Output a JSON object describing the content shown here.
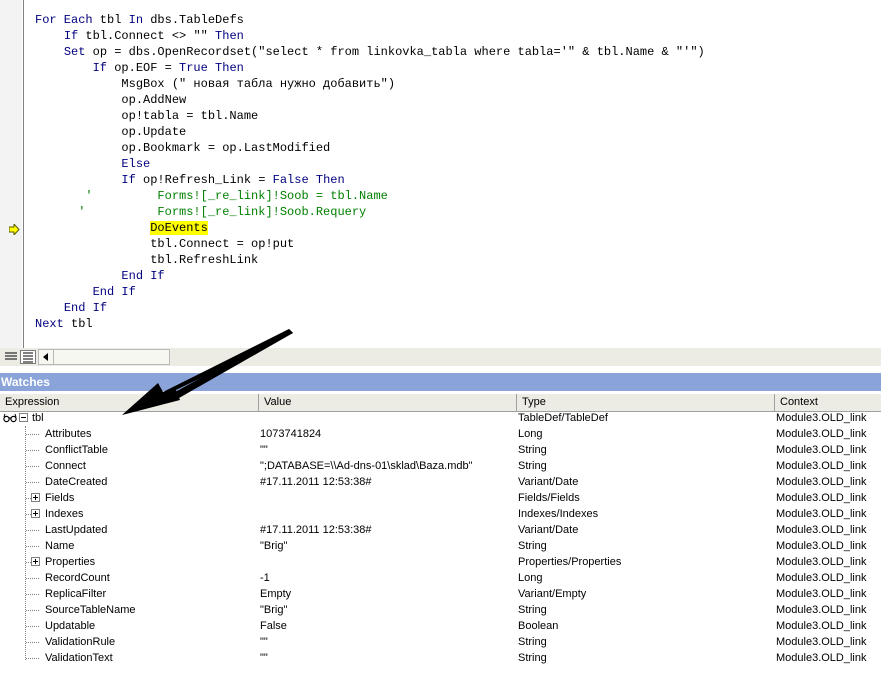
{
  "editor": {
    "lines": [
      [
        {
          "t": "For Each",
          "c": "kw"
        },
        {
          "t": " tbl "
        },
        {
          "t": "In",
          "c": "kw"
        },
        {
          "t": " dbs.TableDefs"
        }
      ],
      [
        {
          "t": "    "
        },
        {
          "t": "If",
          "c": "kw"
        },
        {
          "t": " tbl.Connect <> \"\" "
        },
        {
          "t": "Then",
          "c": "kw"
        }
      ],
      [
        {
          "t": "    "
        },
        {
          "t": "Set",
          "c": "kw"
        },
        {
          "t": " op = dbs.OpenRecordset(\"select * from linkovka_tabla where tabla='\" & tbl.Name & \"'\")"
        }
      ],
      [
        {
          "t": "        "
        },
        {
          "t": "If",
          "c": "kw"
        },
        {
          "t": " op.EOF = "
        },
        {
          "t": "True",
          "c": "kw"
        },
        {
          "t": " "
        },
        {
          "t": "Then",
          "c": "kw"
        }
      ],
      [
        {
          "t": "            MsgBox (\" новая табла нужно добавить\")"
        }
      ],
      [
        {
          "t": "            op.AddNew"
        }
      ],
      [
        {
          "t": "            op!tabla = tbl.Name"
        }
      ],
      [
        {
          "t": "            op.Update"
        }
      ],
      [
        {
          "t": "            op.Bookmark = op.LastModified"
        }
      ],
      [
        {
          "t": "            "
        },
        {
          "t": "Else",
          "c": "kw"
        }
      ],
      [
        {
          "t": "            "
        },
        {
          "t": "If",
          "c": "kw"
        },
        {
          "t": " op!Refresh_Link = "
        },
        {
          "t": "False",
          "c": "kw"
        },
        {
          "t": " "
        },
        {
          "t": "Then",
          "c": "kw"
        }
      ],
      [
        {
          "t": "       '         Forms![_re_link]!Soob = tbl.Name",
          "c": "cm"
        }
      ],
      [
        {
          "t": "      '          Forms![_re_link]!Soob.Requery",
          "c": "cm"
        }
      ],
      [
        {
          "t": "                "
        },
        {
          "t": "DoEvents",
          "c": "hl"
        }
      ],
      [
        {
          "t": "                tbl.Connect = op!put"
        }
      ],
      [
        {
          "t": "                tbl.RefreshLink"
        }
      ],
      [
        {
          "t": "            "
        },
        {
          "t": "End If",
          "c": "kw"
        }
      ],
      [
        {
          "t": "        "
        },
        {
          "t": "End If",
          "c": "kw"
        }
      ],
      [
        {
          "t": "    "
        },
        {
          "t": "End If",
          "c": "kw"
        }
      ],
      [
        {
          "t": "Next",
          "c": "kw"
        },
        {
          "t": " tbl"
        }
      ]
    ]
  },
  "watches": {
    "title": "Watches",
    "columns": {
      "expression": "Expression",
      "value": "Value",
      "type": "Type",
      "context": "Context"
    },
    "root": {
      "expression": "tbl",
      "value": "",
      "type": "TableDef/TableDef",
      "context": "Module3.OLD_link",
      "expanded": true
    },
    "rows": [
      {
        "expression": "Attributes",
        "value": "1073741824",
        "type": "Long",
        "context": "Module3.OLD_link",
        "expandable": false
      },
      {
        "expression": "ConflictTable",
        "value": "\"\"",
        "type": "String",
        "context": "Module3.OLD_link",
        "expandable": false
      },
      {
        "expression": "Connect",
        "value": "\";DATABASE=\\\\Ad-dns-01\\sklad\\Baza.mdb\"",
        "type": "String",
        "context": "Module3.OLD_link",
        "expandable": false
      },
      {
        "expression": "DateCreated",
        "value": "#17.11.2011 12:53:38#",
        "type": "Variant/Date",
        "context": "Module3.OLD_link",
        "expandable": false
      },
      {
        "expression": "Fields",
        "value": "",
        "type": "Fields/Fields",
        "context": "Module3.OLD_link",
        "expandable": true
      },
      {
        "expression": "Indexes",
        "value": "",
        "type": "Indexes/Indexes",
        "context": "Module3.OLD_link",
        "expandable": true
      },
      {
        "expression": "LastUpdated",
        "value": "#17.11.2011 12:53:38#",
        "type": "Variant/Date",
        "context": "Module3.OLD_link",
        "expandable": false
      },
      {
        "expression": "Name",
        "value": "\"Brig\"",
        "type": "String",
        "context": "Module3.OLD_link",
        "expandable": false
      },
      {
        "expression": "Properties",
        "value": "",
        "type": "Properties/Properties",
        "context": "Module3.OLD_link",
        "expandable": true
      },
      {
        "expression": "RecordCount",
        "value": "-1",
        "type": "Long",
        "context": "Module3.OLD_link",
        "expandable": false
      },
      {
        "expression": "ReplicaFilter",
        "value": "Empty",
        "type": "Variant/Empty",
        "context": "Module3.OLD_link",
        "expandable": false
      },
      {
        "expression": "SourceTableName",
        "value": "\"Brig\"",
        "type": "String",
        "context": "Module3.OLD_link",
        "expandable": false
      },
      {
        "expression": "Updatable",
        "value": "False",
        "type": "Boolean",
        "context": "Module3.OLD_link",
        "expandable": false
      },
      {
        "expression": "ValidationRule",
        "value": "\"\"",
        "type": "String",
        "context": "Module3.OLD_link",
        "expandable": false
      },
      {
        "expression": "ValidationText",
        "value": "\"\"",
        "type": "String",
        "context": "Module3.OLD_link",
        "expandable": false
      }
    ]
  },
  "icons": {
    "execution_pointer": "current-line-arrow-icon",
    "watch": "watch-glasses-icon",
    "annotation": "black-arrow-annotation"
  },
  "colors": {
    "keyword": "#00007f",
    "comment": "#007f00",
    "highlight": "#ffff00",
    "watches_title_bg": "#8aa3d8",
    "exec_arrow_fill": "#ffff00"
  }
}
